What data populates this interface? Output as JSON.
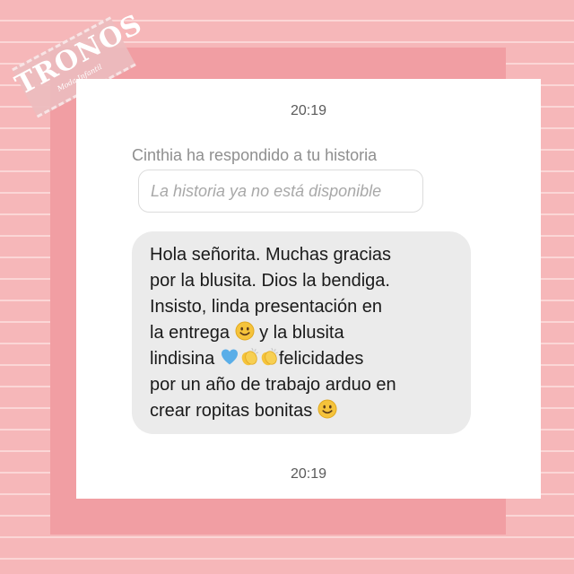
{
  "brand": {
    "name": "TRONOS",
    "tagline": "Moda Infantil"
  },
  "chat": {
    "timestamp_top": "20:19",
    "reply_label": "Cinthia ha respondido a tu historia",
    "story_unavailable": "La historia ya no está disponible",
    "message_lines": [
      "Hola señorita. Muchas gracias",
      "por la blusita. Dios la bendiga.",
      "Insisto, linda presentación en",
      "la entrega",
      "y la blusita",
      "lindisina",
      "felicidades",
      "por un año de trabajo arduo en",
      "crear ropitas bonitas"
    ],
    "emoji_names": [
      "smiling-face-emoji",
      "blue-heart-emoji",
      "clapping-hands-emoji"
    ],
    "timestamp_bottom": "20:19"
  },
  "colors": {
    "background_pink": "#f6b7b9",
    "frame_pink": "#f19ea3",
    "card": "#ffffff",
    "bubble": "#ebebeb"
  }
}
